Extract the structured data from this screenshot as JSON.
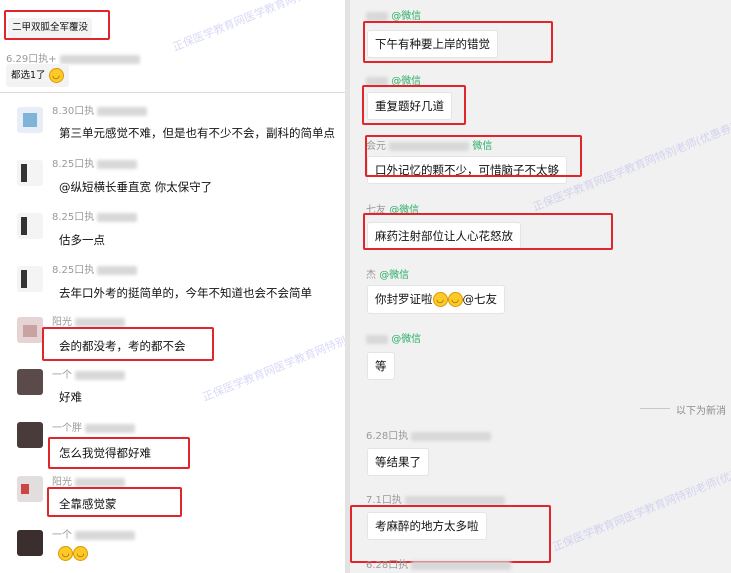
{
  "left": {
    "top_box": "二甲双胍全军覆没",
    "meta_top": "6.29口执+",
    "msg_top": "都选1了",
    "messages": [
      {
        "meta": "8.30口执",
        "text": "第三单元感觉不难，但是也有不少不会，副科的简单点"
      },
      {
        "meta": "8.25口执",
        "text": "@纵短横长垂直宽 你太保守了"
      },
      {
        "meta": "8.25口执",
        "text": "估多一点"
      },
      {
        "meta": "8.25口执",
        "text": "去年口外考的挺简单的，今年不知道也会不会简单"
      },
      {
        "meta": "阳光",
        "text": "会的都没考，考的都不会"
      },
      {
        "meta": "一个",
        "text": "好难"
      },
      {
        "meta": "一个胖",
        "text": "怎么我觉得都好难"
      },
      {
        "meta": "阳光",
        "text": "全靠感觉蒙"
      },
      {
        "meta": "一个",
        "text": ""
      }
    ]
  },
  "right": {
    "messages": [
      {
        "meta_name": "",
        "meta_src": "@微信",
        "text": "下午有种要上岸的错觉"
      },
      {
        "meta_name": "",
        "meta_src": "@微信",
        "text": "重复题好几道"
      },
      {
        "meta_name": "会元",
        "meta_src": "微信",
        "text": "口外记忆的颗不少，可惜脑子不太够"
      },
      {
        "meta_name": "七友",
        "meta_src": "@微信",
        "text": "麻药注射部位让人心花怒放"
      },
      {
        "meta_name": "杰",
        "meta_src": "@微信",
        "text": "你封罗证啦",
        "mention": "@七友"
      },
      {
        "meta_name": "",
        "meta_src": "@微信",
        "text": "等"
      },
      {
        "meta_name": "6.28口执",
        "meta_src": "",
        "text": "等结果了"
      },
      {
        "meta_name": "7.1口执",
        "meta_src": "",
        "text": "考麻醉的地方太多啦"
      },
      {
        "meta_name": "6.28口执",
        "meta_src": "",
        "text": ""
      }
    ],
    "divider": "以下为新消"
  },
  "watermark": "正保医学教育网医学教育网特别老师(优惠券) j5719",
  "accent": "#e0262b"
}
